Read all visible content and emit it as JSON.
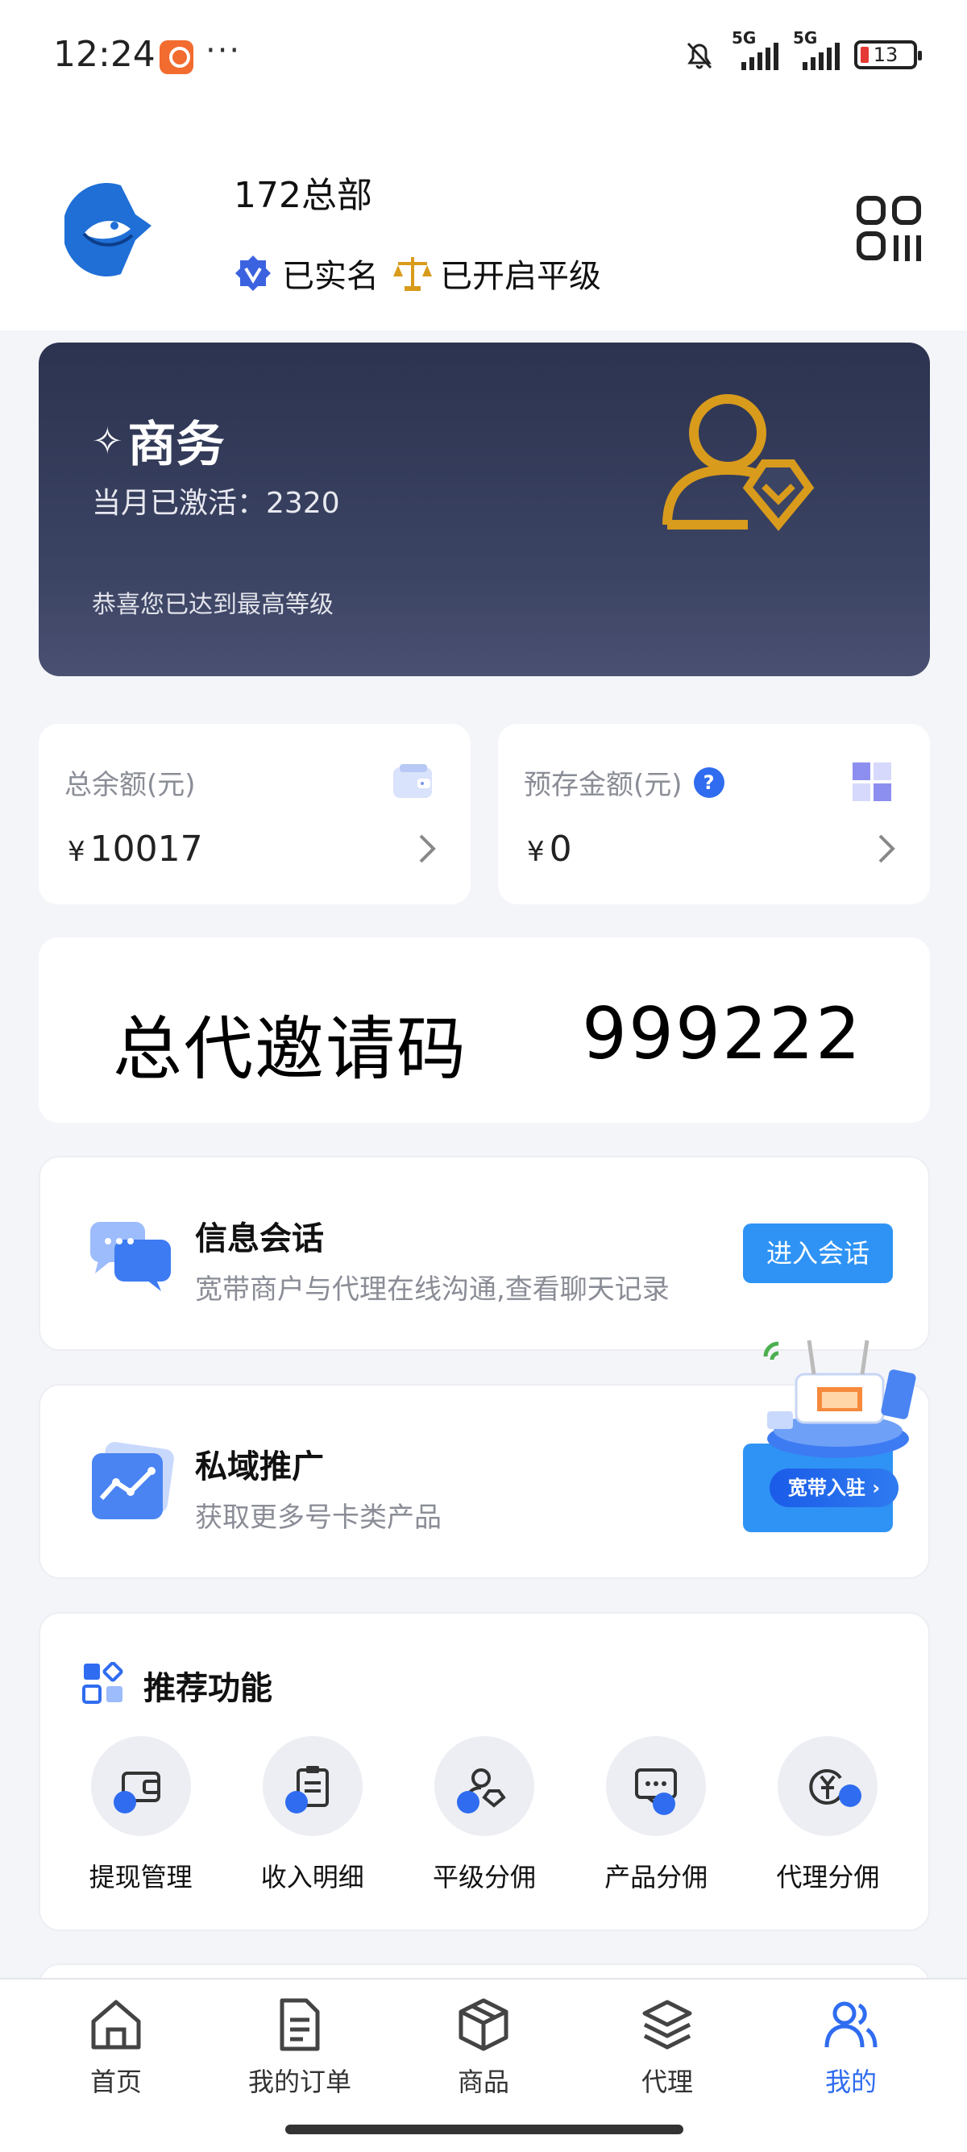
{
  "status_bar": {
    "time": "12:24",
    "dots": "···",
    "network_1": "5G",
    "network_2": "5G",
    "battery": "13"
  },
  "header": {
    "shop_name": "172总部",
    "verified_label": "已实名",
    "level_sync_label": "已开启平级",
    "qr_icon": "qr-code-icon"
  },
  "level_card": {
    "title": "商务",
    "activated_label": "当月已激活：",
    "activated_count": "2320",
    "note": "恭喜您已达到最高等级"
  },
  "balances": [
    {
      "label": "总余额(元)",
      "currency": "¥",
      "value": "10017",
      "icon": "wallet-icon"
    },
    {
      "label": "预存金额(元)",
      "currency": "¥",
      "value": "0",
      "icon": "grid-icon",
      "help": "?"
    }
  ],
  "invite": {
    "label": "总代邀请码",
    "code": "999222"
  },
  "chat_card": {
    "title": "信息会话",
    "desc": "宽带商户与代理在线沟通,查看聊天记录",
    "button": "进入会话"
  },
  "promo_card": {
    "title": "私域推广",
    "desc": "获取更多号卡类产品",
    "tag": "宽带入驻 ›"
  },
  "recommend": {
    "title": "推荐功能",
    "items": [
      {
        "label": "提现管理",
        "icon": "wallet-icon"
      },
      {
        "label": "收入明细",
        "icon": "clipboard-icon"
      },
      {
        "label": "平级分佣",
        "icon": "user-badge-icon"
      },
      {
        "label": "产品分佣",
        "icon": "chat-icon"
      },
      {
        "label": "代理分佣",
        "icon": "yuan-coin-icon"
      }
    ]
  },
  "tabbar": {
    "items": [
      {
        "label": "首页",
        "icon": "home-icon"
      },
      {
        "label": "我的订单",
        "icon": "document-icon"
      },
      {
        "label": "商品",
        "icon": "box-icon"
      },
      {
        "label": "代理",
        "icon": "layers-icon"
      },
      {
        "label": "我的",
        "icon": "users-icon",
        "active": true
      }
    ]
  },
  "colors": {
    "accent": "#2f6cf0",
    "button": "#2f93f5",
    "card_dark": "#2c3350",
    "gold": "#d89b1c"
  }
}
